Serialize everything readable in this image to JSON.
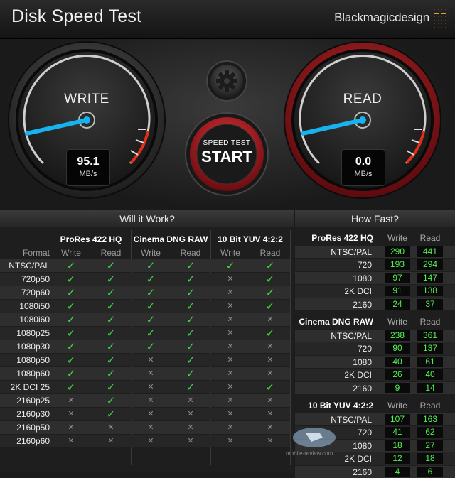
{
  "app": {
    "title": "Disk Speed Test",
    "brand": "Blackmagicdesign"
  },
  "gauges": {
    "write": {
      "label": "WRITE",
      "value": "95.1",
      "unit": "MB/s",
      "needle_fraction": 0.12
    },
    "read": {
      "label": "READ",
      "value": "0.0",
      "unit": "MB/s",
      "needle_fraction": 0.12
    }
  },
  "start_button": {
    "top": "SPEED TEST",
    "main": "START"
  },
  "will_it_work": {
    "header": "Will it Work?",
    "format_label": "Format",
    "groups": [
      {
        "name": "ProRes 422 HQ",
        "write": "Write",
        "read": "Read"
      },
      {
        "name": "Cinema DNG RAW",
        "write": "Write",
        "read": "Read"
      },
      {
        "name": "10 Bit YUV 4:2:2",
        "write": "Write",
        "read": "Read"
      }
    ],
    "symbols": {
      "yes": "✓",
      "no": "✕"
    },
    "rows": [
      {
        "format": "NTSC/PAL",
        "cells": [
          1,
          1,
          1,
          1,
          1,
          1
        ]
      },
      {
        "format": "720p50",
        "cells": [
          1,
          1,
          1,
          1,
          0,
          1
        ]
      },
      {
        "format": "720p60",
        "cells": [
          1,
          1,
          1,
          1,
          0,
          1
        ]
      },
      {
        "format": "1080i50",
        "cells": [
          1,
          1,
          1,
          1,
          0,
          1
        ]
      },
      {
        "format": "1080i60",
        "cells": [
          1,
          1,
          1,
          1,
          0,
          0
        ]
      },
      {
        "format": "1080p25",
        "cells": [
          1,
          1,
          1,
          1,
          0,
          1
        ]
      },
      {
        "format": "1080p30",
        "cells": [
          1,
          1,
          1,
          1,
          0,
          0
        ]
      },
      {
        "format": "1080p50",
        "cells": [
          1,
          1,
          0,
          1,
          0,
          0
        ]
      },
      {
        "format": "1080p60",
        "cells": [
          1,
          1,
          0,
          1,
          0,
          0
        ]
      },
      {
        "format": "2K DCI 25",
        "cells": [
          1,
          1,
          0,
          1,
          0,
          1
        ]
      },
      {
        "format": "2160p25",
        "cells": [
          0,
          1,
          0,
          0,
          0,
          0
        ]
      },
      {
        "format": "2160p30",
        "cells": [
          0,
          1,
          0,
          0,
          0,
          0
        ]
      },
      {
        "format": "2160p50",
        "cells": [
          0,
          0,
          0,
          0,
          0,
          0
        ]
      },
      {
        "format": "2160p60",
        "cells": [
          0,
          0,
          0,
          0,
          0,
          0
        ]
      }
    ]
  },
  "how_fast": {
    "header": "How Fast?",
    "write_label": "Write",
    "read_label": "Read",
    "groups": [
      {
        "name": "ProRes 422 HQ",
        "rows": [
          {
            "format": "NTSC/PAL",
            "write": "290",
            "read": "441"
          },
          {
            "format": "720",
            "write": "193",
            "read": "294"
          },
          {
            "format": "1080",
            "write": "97",
            "read": "147"
          },
          {
            "format": "2K DCI",
            "write": "91",
            "read": "138"
          },
          {
            "format": "2160",
            "write": "24",
            "read": "37"
          }
        ]
      },
      {
        "name": "Cinema DNG RAW",
        "rows": [
          {
            "format": "NTSC/PAL",
            "write": "238",
            "read": "361"
          },
          {
            "format": "720",
            "write": "90",
            "read": "137"
          },
          {
            "format": "1080",
            "write": "40",
            "read": "61"
          },
          {
            "format": "2K DCI",
            "write": "26",
            "read": "40"
          },
          {
            "format": "2160",
            "write": "9",
            "read": "14"
          }
        ]
      },
      {
        "name": "10 Bit YUV 4:2:2",
        "rows": [
          {
            "format": "NTSC/PAL",
            "write": "107",
            "read": "163"
          },
          {
            "format": "720",
            "write": "41",
            "read": "62"
          },
          {
            "format": "1080",
            "write": "18",
            "read": "27"
          },
          {
            "format": "2K DCI",
            "write": "12",
            "read": "18"
          },
          {
            "format": "2160",
            "write": "4",
            "read": "6"
          }
        ]
      }
    ]
  },
  "watermark": {
    "text": "mobile-review.com"
  },
  "colors": {
    "accent_red": "#c0202a",
    "needle_blue": "#17b3f0",
    "ok_green": "#42d642",
    "value_green": "#52f052"
  }
}
